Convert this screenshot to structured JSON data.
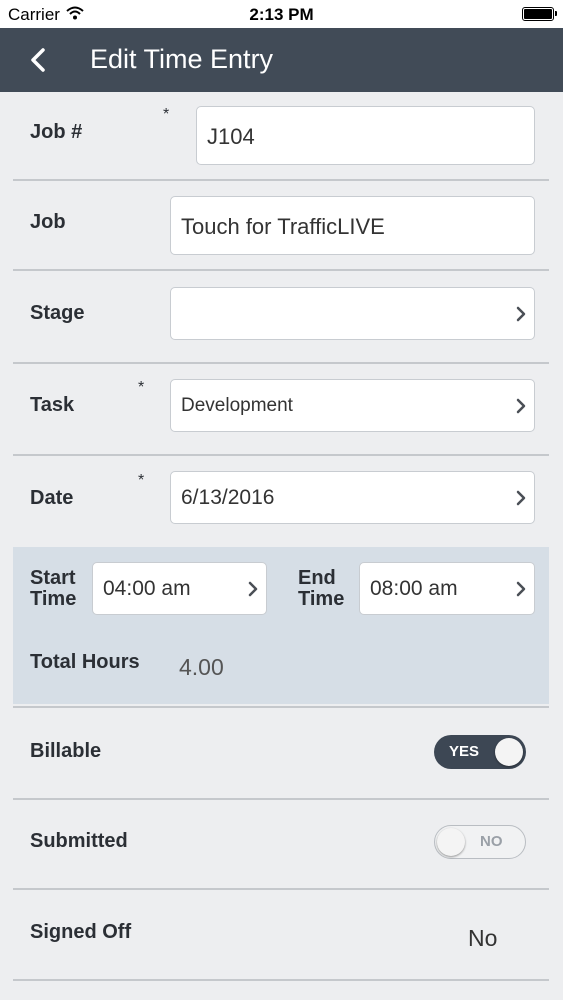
{
  "status_bar": {
    "carrier": "Carrier",
    "time": "2:13 PM",
    "wifi_icon": "wifi-icon",
    "battery_icon": "battery-icon"
  },
  "nav": {
    "title": "Edit Time Entry",
    "back_icon": "chevron-left-icon"
  },
  "form": {
    "job_number": {
      "label": "Job #",
      "required": "*",
      "value": "J104"
    },
    "job": {
      "label": "Job",
      "value": "Touch for TrafficLIVE"
    },
    "stage": {
      "label": "Stage",
      "value": ""
    },
    "task": {
      "label": "Task",
      "required": "*",
      "value": "Development"
    },
    "date": {
      "label": "Date",
      "required": "*",
      "value": "6/13/2016"
    },
    "start_time": {
      "label_line1": "Start",
      "label_line2": "Time",
      "value": "04:00 am"
    },
    "end_time": {
      "label_line1": "End",
      "label_line2": "Time",
      "value": "08:00 am"
    },
    "total_hours": {
      "label": "Total Hours",
      "value": "4.00"
    },
    "billable": {
      "label": "Billable",
      "toggle_text": "YES",
      "on": true
    },
    "submitted": {
      "label": "Submitted",
      "toggle_text": "NO",
      "on": false
    },
    "signed_off": {
      "label": "Signed Off",
      "value": "No"
    }
  },
  "colors": {
    "nav_background": "#414b57",
    "time_panel_background": "#d6dee6",
    "page_background": "#edeef0",
    "toggle_on": "#3d4754"
  }
}
